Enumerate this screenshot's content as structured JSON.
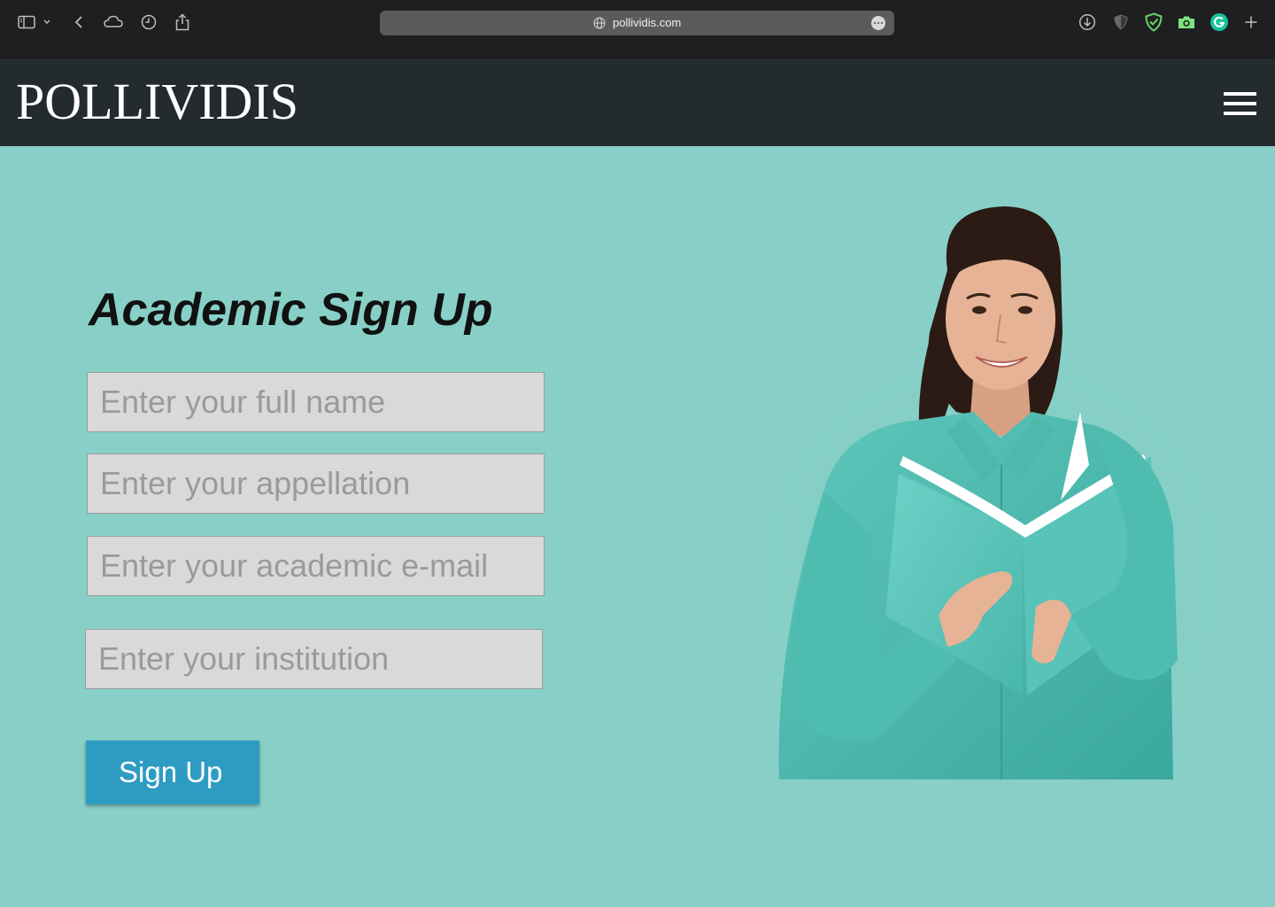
{
  "browser": {
    "url": "pollividis.com",
    "icons": [
      "sidebar-icon",
      "chevron-down-icon",
      "back-icon",
      "cloud-icon",
      "history-icon",
      "share-icon",
      "download-icon",
      "privacy-shield-icon",
      "adguard-icon",
      "camera-icon",
      "grammarly-icon",
      "new-tab-icon",
      "more-icon",
      "globe-icon"
    ]
  },
  "header": {
    "logo": "POLLIVIDIS",
    "menu_icon": "hamburger-menu-icon",
    "background": "#232b2e"
  },
  "form": {
    "title": "Academic Sign Up",
    "full_name_placeholder": "Enter your full name",
    "appellation_placeholder": "Enter your appellation",
    "email_placeholder": "Enter your academic e-mail",
    "institution_placeholder": "Enter your institution",
    "submit_label": "Sign Up"
  },
  "colors": {
    "page_background": "#88d0c7",
    "button": "#2e9bc3",
    "field_background": "#d9d9d9"
  }
}
